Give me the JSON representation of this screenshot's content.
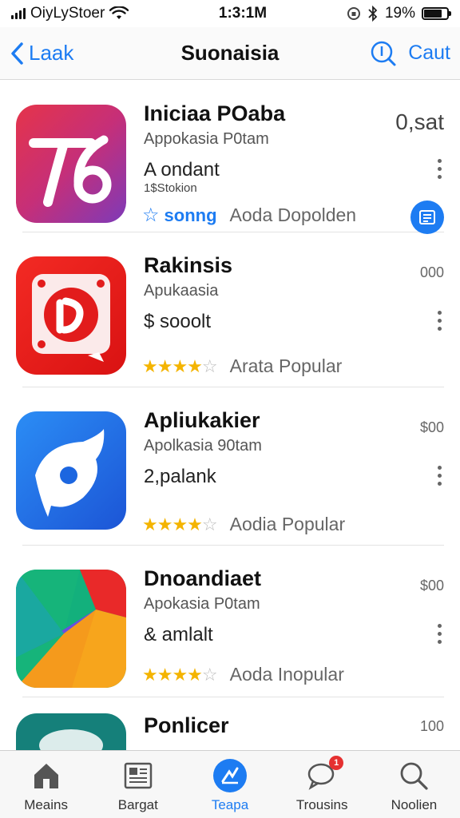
{
  "status_bar": {
    "carrier": "OiyLyStoer",
    "time": "1:3:1M",
    "battery_percent": "19%"
  },
  "nav": {
    "back_label": "Laak",
    "title": "Suonaisia",
    "right_label": "Caut"
  },
  "apps": [
    {
      "title": "Iniciaa POaba",
      "subtitle": "Appokasia P0tam",
      "line": "A ondant",
      "small": "1$Stokion",
      "price": "0,sat",
      "rating_label": "sonng",
      "tag": "Aoda Dopolden",
      "icon": "app-icon-1"
    },
    {
      "title": "Rakinsis",
      "subtitle": "Apukaasia",
      "line": "$ sooolt",
      "price": "000",
      "stars": 4,
      "tag": "Arata Popular",
      "icon": "app-icon-2"
    },
    {
      "title": "Apliukakier",
      "subtitle": "Apolkasia 90tam",
      "line": "2,palank",
      "price": "$00",
      "stars": 4,
      "tag": "Aodia Popular",
      "icon": "app-icon-3"
    },
    {
      "title": "Dnoandiaet",
      "subtitle": "Apokasia P0tam",
      "line": "& amlalt",
      "price": "$00",
      "stars": 4,
      "tag": "Aoda Inopular",
      "icon": "app-icon-4"
    },
    {
      "title": "Ponlicer",
      "price": "100",
      "icon": "app-icon-5"
    }
  ],
  "tabs": [
    {
      "label": "Meains",
      "icon": "home-icon"
    },
    {
      "label": "Bargat",
      "icon": "newspaper-icon"
    },
    {
      "label": "Teapa",
      "icon": "apps-icon",
      "active": true
    },
    {
      "label": "Trousins",
      "icon": "chat-icon",
      "badge": "1"
    },
    {
      "label": "Noolien",
      "icon": "search-icon"
    }
  ],
  "colors": {
    "accent": "#1d7cf2",
    "star": "#f4b400",
    "badge": "#e53030"
  }
}
